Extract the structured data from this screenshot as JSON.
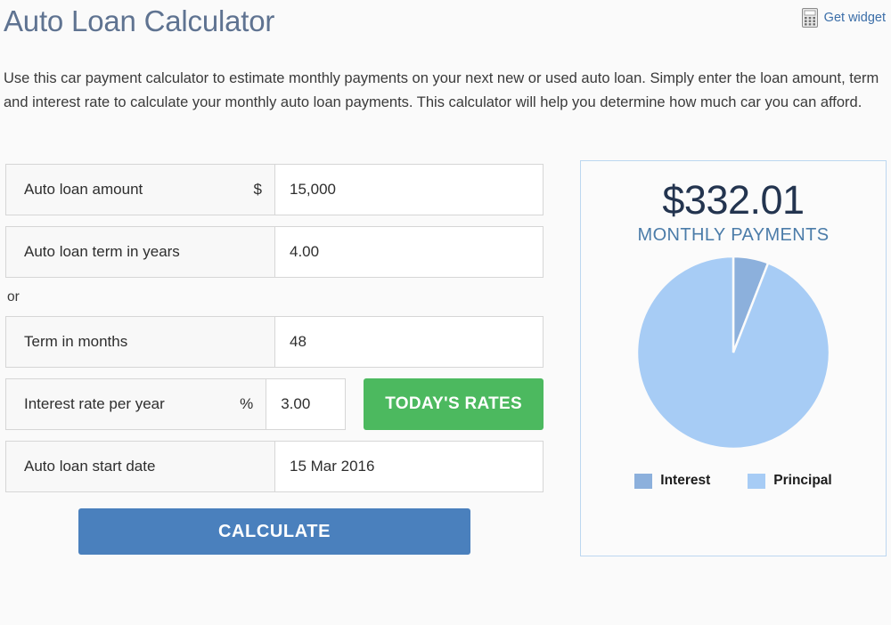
{
  "header": {
    "title": "Auto Loan Calculator",
    "widget_link_label": "Get widget",
    "widget_icon": "calculator-icon"
  },
  "intro": "Use this car payment calculator to estimate monthly payments on your next new or used auto loan. Simply enter the loan amount, term and interest rate to calculate your monthly auto loan payments. This calculator will help you determine how much car you can afford.",
  "form": {
    "or_text": "or",
    "fields": [
      {
        "label": "Auto loan amount",
        "unit": "$",
        "value": "15,000"
      },
      {
        "label": "Auto loan term in years",
        "unit": "",
        "value": "4.00"
      },
      {
        "label": "Term in months",
        "unit": "",
        "value": "48"
      },
      {
        "label": "Interest rate per year",
        "unit": "%",
        "value": "3.00"
      },
      {
        "label": "Auto loan start date",
        "unit": "",
        "value": "15 Mar 2016"
      }
    ],
    "todays_rates_label": "TODAY'S RATES",
    "calculate_label": "CALCULATE"
  },
  "result": {
    "amount": "$332.01",
    "caption": "MONTHLY PAYMENTS"
  },
  "colors": {
    "title": "#5f7391",
    "link": "#3b6ea8",
    "calculate_button": "#4a80bd",
    "rates_button": "#4cb95f",
    "panel_border": "#bcd7f0",
    "amount": "#23344f",
    "caption": "#4b7ca9",
    "interest": "#8cb0dc",
    "principal": "#a7ccf5"
  },
  "chart_data": {
    "type": "pie",
    "title": "",
    "labels": [
      "Interest",
      "Principal"
    ],
    "values": [
      5.9,
      94.1
    ],
    "colors": [
      "#8cb0dc",
      "#a7ccf5"
    ],
    "legend_position": "bottom",
    "start_angle": 90,
    "direction": "clockwise"
  }
}
